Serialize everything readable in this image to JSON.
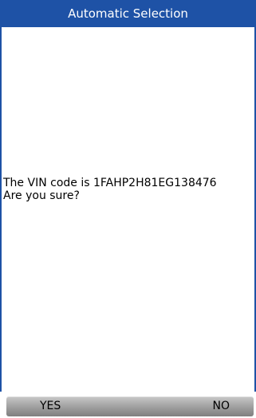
{
  "header": {
    "title": "Automatic Selection"
  },
  "dialog": {
    "line1": "The VIN code is 1FAHP2H81EG138476",
    "line2": "Are you sure?"
  },
  "buttons": {
    "yes_label": "YES",
    "no_label": "NO"
  },
  "colors": {
    "title_bar": "#1e52a6",
    "background": "#ffffff"
  }
}
